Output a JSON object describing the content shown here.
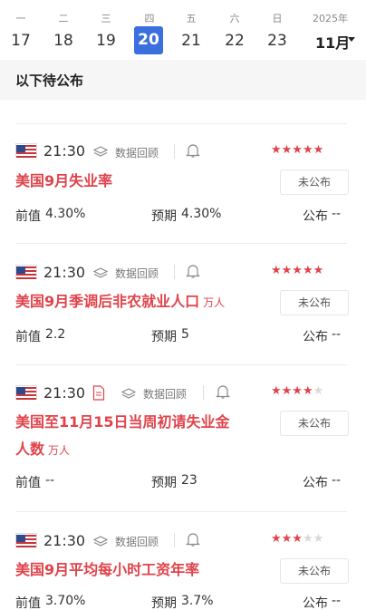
{
  "calendar": {
    "days": [
      {
        "name": "一",
        "num": "17"
      },
      {
        "name": "二",
        "num": "18"
      },
      {
        "name": "三",
        "num": "19"
      },
      {
        "name": "四",
        "num": "20"
      },
      {
        "name": "五",
        "num": "21"
      },
      {
        "name": "六",
        "num": "22"
      },
      {
        "name": "日",
        "num": "23"
      }
    ],
    "active_index": 3,
    "year": "2025年",
    "month": "11月"
  },
  "section": {
    "title": "以下待公布"
  },
  "events": [
    {
      "time": "21:30",
      "source_label": "数据回顾",
      "stars": 5,
      "title": "美国9月失业率",
      "unit": "",
      "status": "未公布",
      "prev_label": "前值",
      "prev_value": "4.30%",
      "forecast_label": "预期",
      "forecast_value": "4.30%",
      "actual_label": "公布",
      "actual_value": "--"
    },
    {
      "time": "21:30",
      "source_label": "数据回顾",
      "stars": 5,
      "title": "美国9月季调后非农就业人口",
      "unit": "万人",
      "status": "未公布",
      "prev_label": "前值",
      "prev_value": "2.2",
      "forecast_label": "预期",
      "forecast_value": "5",
      "actual_label": "公布",
      "actual_value": "--"
    },
    {
      "time": "21:30",
      "source_label": "数据回顾",
      "stars": 4,
      "title_line1": "美国至11月15日当周初请失业金",
      "title_line2": "人数",
      "unit": "万人",
      "status": "未公布",
      "prev_label": "前值",
      "prev_value": "--",
      "forecast_label": "预期",
      "forecast_value": "23",
      "actual_label": "公布",
      "actual_value": "--"
    },
    {
      "time": "21:30",
      "source_label": "数据回顾",
      "stars": 3,
      "title": "美国9月平均每小时工资年率",
      "unit": "",
      "status": "未公布",
      "prev_label": "前值",
      "prev_value": "3.70%",
      "forecast_label": "预期",
      "forecast_value": "3.7%",
      "actual_label": "公布",
      "actual_value": "--"
    }
  ],
  "colors": {
    "accent": "#e0434b",
    "active_day": "#3b6fde"
  },
  "icons": [
    "us-flag-icon",
    "layers-icon",
    "document-icon",
    "bell-icon",
    "star-icon",
    "caret-down-icon"
  ]
}
